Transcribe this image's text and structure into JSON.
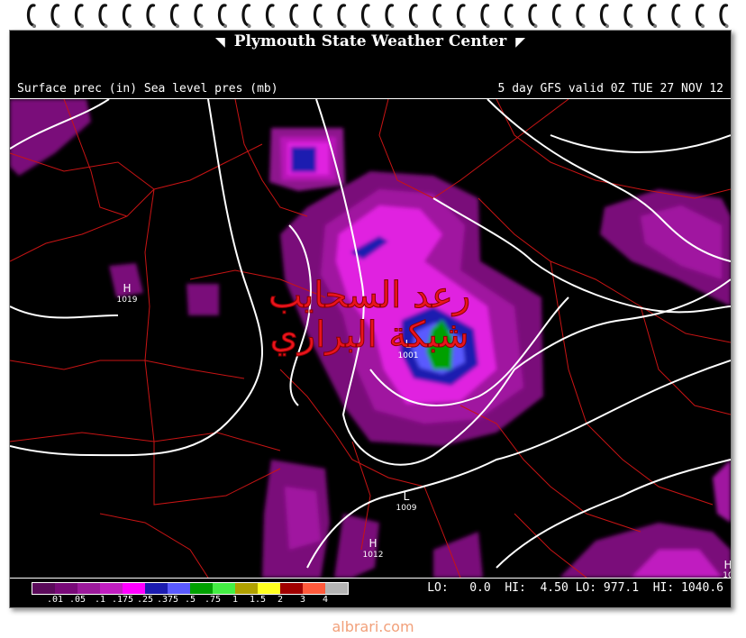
{
  "title": "Plymouth State Weather Center",
  "header": {
    "left": "Surface prec (in) Sea level pres (mb)",
    "right": "5 day GFS valid 0Z TUE 27 NOV 12"
  },
  "legend": {
    "colors": [
      "#5a0a5a",
      "#780a78",
      "#9b1a9b",
      "#c01ec0",
      "#ff00ff",
      "#1c1cb0",
      "#5a5aff",
      "#00a000",
      "#44ee44",
      "#b0a000",
      "#ffff20",
      "#a00000",
      "#ff5a3c",
      "#b4b4b4"
    ],
    "labels": [
      ".01",
      ".05",
      ".1",
      ".175",
      ".25",
      ".375",
      ".5",
      ".75",
      "1",
      "1.5",
      "2",
      "3",
      "4"
    ]
  },
  "stats": {
    "lo_label": "LO:",
    "lo_value": "0.0",
    "hi_label": "HI:",
    "hi_value": "4.50",
    "lo2_label": "LO:",
    "lo2_value": "977.1",
    "hi2_label": "HI:",
    "hi2_value": "1040.6"
  },
  "pressure_centers": [
    {
      "type": "H",
      "value": "1019"
    },
    {
      "type": "L",
      "value": "1009"
    },
    {
      "type": "L",
      "value": "1001"
    },
    {
      "type": "H",
      "value": "1012"
    },
    {
      "type": "H",
      "value": "10"
    }
  ],
  "watermark": {
    "line1": "رعد السحايب",
    "line2": "شبكة البراري"
  },
  "footer_site": "albrari.com"
}
